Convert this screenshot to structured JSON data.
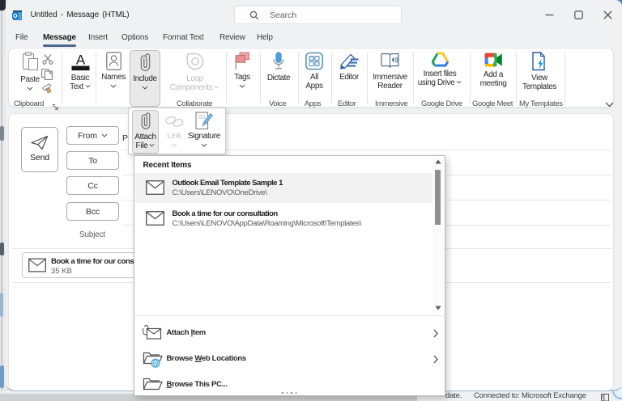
{
  "window": {
    "title": "Untitled - Message (HTML)",
    "search_placeholder": "Search"
  },
  "menu": {
    "items": [
      "File",
      "Message",
      "Insert",
      "Options",
      "Format Text",
      "Review",
      "Help"
    ],
    "active_item": "Message"
  },
  "ribbon": {
    "paste": {
      "label": "Paste",
      "icon": "paste-clipboard-icon"
    },
    "small_icons": [
      "cut-icon",
      "copy-icon",
      "format-painter-icon"
    ],
    "clipboard_group": "Clipboard",
    "basic_text": {
      "line1": "Basic",
      "line2": "Text",
      "icon": "font-a-icon"
    },
    "names": {
      "label": "Names",
      "icon": "contact-card-icon"
    },
    "include": {
      "label": "Include",
      "icon": "paperclip-icon",
      "state": "pressed"
    },
    "loop": {
      "line1": "Loop",
      "line2": "Components",
      "icon": "loop-icon",
      "state": "disabled"
    },
    "collaborate_group": "Collaborate",
    "tags": {
      "label": "Tags",
      "icon": "flag-icon"
    },
    "dictate": {
      "label": "Dictate",
      "icon": "microphone-icon"
    },
    "voice_group": "Voice",
    "all_apps": {
      "line1": "All",
      "line2": "Apps",
      "icon": "apps-grid-icon"
    },
    "apps_group": "Apps",
    "editor": {
      "label": "Editor",
      "icon": "editor-pencil-icon"
    },
    "editor_group": "Editor",
    "immersive": {
      "line1": "Immersive",
      "line2": "Reader",
      "icon": "immersive-reader-icon"
    },
    "immersive_group": "Immersive",
    "drive": {
      "line1": "Insert files",
      "line2": "using Drive",
      "icon": "google-drive-icon"
    },
    "drive_group": "Google Drive",
    "meet": {
      "line1": "Add a",
      "line2": "meeting",
      "icon": "google-meet-icon"
    },
    "meet_group": "Google Meet",
    "templates": {
      "line1": "View",
      "line2": "Templates",
      "icon": "view-templates-icon"
    },
    "templates_group": "My Templates"
  },
  "compose": {
    "send_label": "Send",
    "from_label": "From",
    "to_label": "To",
    "cc_label": "Cc",
    "bcc_label": "Bcc",
    "subject_label": "Subject",
    "from_value_partial": "P",
    "attachment": {
      "name": "Book a time for our consu",
      "size": "35 KB",
      "icon": "envelope-icon"
    }
  },
  "include_menu": {
    "attach_file": {
      "line1": "Attach",
      "line2": "File",
      "icon": "paperclip-icon",
      "state": "pressed"
    },
    "link": {
      "label": "Link",
      "icon": "link-icon",
      "state": "disabled"
    },
    "signature": {
      "label": "Signature",
      "icon": "signature-icon"
    }
  },
  "attach_menu": {
    "header": "Recent Items",
    "recent_items": [
      {
        "title": "Outlook Email Template Sample 1",
        "path": "C:\\Users\\LENOVO\\OneDrive\\",
        "icon": "envelope-icon"
      },
      {
        "title": "Book a time for our consultation",
        "path": "C:\\Users\\LENOVO\\AppData\\Roaming\\Microsoft\\Templates\\",
        "icon": "envelope-icon"
      }
    ],
    "actions": [
      {
        "label": "Attach Item",
        "pre": "Attach ",
        "accel": "I",
        "post": "tem",
        "icon": "attach-item-icon",
        "has_arrow": true
      },
      {
        "label": "Browse Web Locations",
        "pre": "Browse ",
        "accel": "W",
        "post": "eb Locations",
        "icon": "browse-web-icon",
        "has_arrow": true
      },
      {
        "label": "Browse This PC...",
        "pre": "",
        "accel": "B",
        "post": "rowse This PC...",
        "icon": "browse-pc-icon",
        "has_arrow": false
      }
    ]
  },
  "statusbar": {
    "left_partial": "date.",
    "connection": "Connected to: Microsoft Exchange",
    "icon": "reading-pane-icon"
  },
  "colors": {
    "accent_underline": "#49688c",
    "pressed_button_bg": "#e9e9e9",
    "window_bg": "#f0f1f2",
    "flag_red": "#ef8e8e",
    "mic_blue": "#4ba0dc",
    "editor_blue": "#2b5c9e"
  }
}
